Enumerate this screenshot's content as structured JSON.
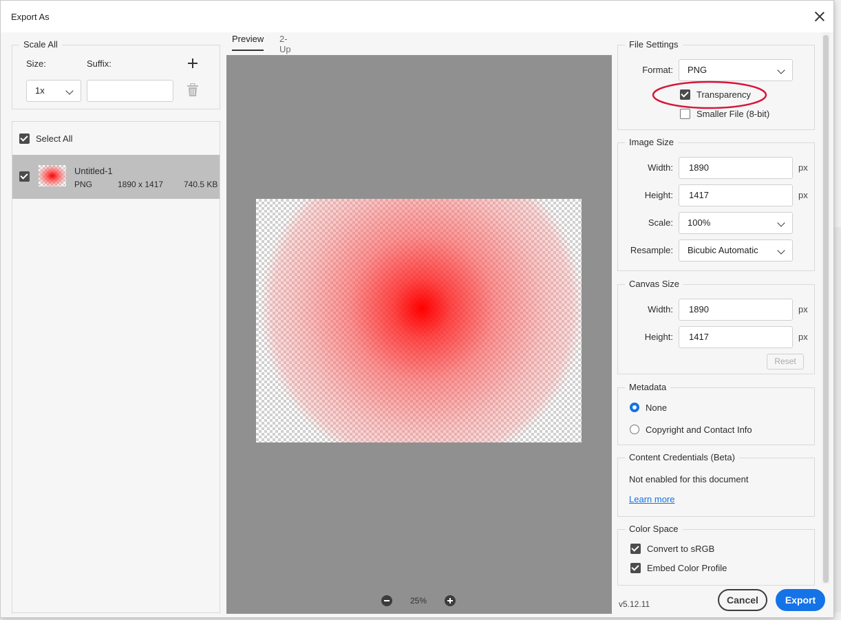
{
  "window": {
    "title": "Export As"
  },
  "scale_all": {
    "legend": "Scale All",
    "size_label": "Size:",
    "suffix_label": "Suffix:",
    "size_value": "1x",
    "suffix_value": ""
  },
  "assets": {
    "select_all_label": "Select All",
    "items": [
      {
        "name": "Untitled-1",
        "format": "PNG",
        "dimensions": "1890 x 1417",
        "file_size": "740.5 KB"
      }
    ]
  },
  "preview": {
    "tabs": [
      {
        "label": "Preview"
      },
      {
        "label": "2-Up"
      }
    ],
    "zoom": "25%"
  },
  "file_settings": {
    "legend": "File Settings",
    "format_label": "Format:",
    "format_value": "PNG",
    "transparency_label": "Transparency",
    "transparency_checked": true,
    "smaller_file_label": "Smaller File (8-bit)",
    "smaller_file_checked": false
  },
  "image_size": {
    "legend": "Image Size",
    "width_label": "Width:",
    "width_value": "1890",
    "height_label": "Height:",
    "height_value": "1417",
    "scale_label": "Scale:",
    "scale_value": "100%",
    "resample_label": "Resample:",
    "resample_value": "Bicubic Automatic",
    "unit": "px"
  },
  "canvas_size": {
    "legend": "Canvas Size",
    "width_label": "Width:",
    "width_value": "1890",
    "height_label": "Height:",
    "height_value": "1417",
    "unit": "px",
    "reset_label": "Reset"
  },
  "metadata": {
    "legend": "Metadata",
    "options": [
      {
        "label": "None",
        "selected": true
      },
      {
        "label": "Copyright and Contact Info",
        "selected": false
      }
    ]
  },
  "content_credentials": {
    "legend": "Content Credentials (Beta)",
    "status": "Not enabled for this document",
    "link": "Learn more"
  },
  "color_space": {
    "legend": "Color Space",
    "convert_label": "Convert to sRGB",
    "embed_label": "Embed Color Profile"
  },
  "footer": {
    "version": "v5.12.11",
    "cancel_label": "Cancel",
    "export_label": "Export"
  },
  "colors": {
    "accent": "#1473e6",
    "annotation": "#d6163a",
    "preview_bg": "#909090"
  }
}
